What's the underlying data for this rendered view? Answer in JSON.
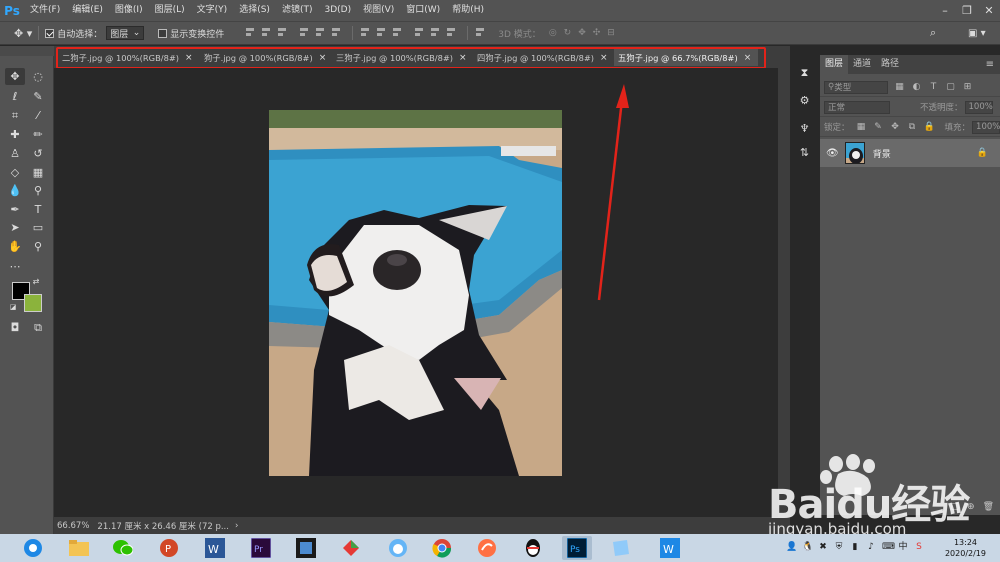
{
  "app": {
    "logo": "Ps"
  },
  "menu": [
    "文件(F)",
    "编辑(E)",
    "图像(I)",
    "图层(L)",
    "文字(Y)",
    "选择(S)",
    "滤镜(T)",
    "3D(D)",
    "视图(V)",
    "窗口(W)",
    "帮助(H)"
  ],
  "options": {
    "auto_select_label": "自动选择：",
    "auto_select_value": "图层",
    "show_transform_label": "显示变换控件",
    "mode_3d_label": "3D 模式："
  },
  "tabs": [
    {
      "label": "二狗子.jpg @ 100%(RGB/8#)",
      "close": "×"
    },
    {
      "label": "狗子.jpg @ 100%(RGB/8#)",
      "close": "×"
    },
    {
      "label": "三狗子.jpg @ 100%(RGB/8#)",
      "close": "×"
    },
    {
      "label": "四狗子.jpg @ 100%(RGB/8#)",
      "close": "×"
    },
    {
      "label": "五狗子.jpg @ 66.7%(RGB/8#)",
      "close": "×",
      "active": true
    }
  ],
  "layers_panel": {
    "tabs": [
      "图层",
      "通道",
      "路径"
    ],
    "filter_placeholder": "类型",
    "blend_mode": "正常",
    "opacity_label": "不透明度：",
    "opacity_value": "100%",
    "lock_label": "锁定：",
    "fill_label": "填充：",
    "fill_value": "100%",
    "layers": [
      {
        "name": "背景",
        "visible": true,
        "locked": true
      }
    ]
  },
  "status": {
    "zoom": "66.67%",
    "doc_info": "21.17 厘米 x 26.46 厘米 (72 p...",
    "arrow": "›"
  },
  "watermark": {
    "brand": "Baidu经验",
    "url": "jingyan.baidu.com"
  },
  "taskbar": {
    "time": "13:24",
    "date": "2020/2/19",
    "ime": "中"
  },
  "colors": {
    "foreground": "#000000",
    "background": "#8bb33c",
    "highlight": "#e2231a",
    "ps_blue": "#31a8ff"
  }
}
